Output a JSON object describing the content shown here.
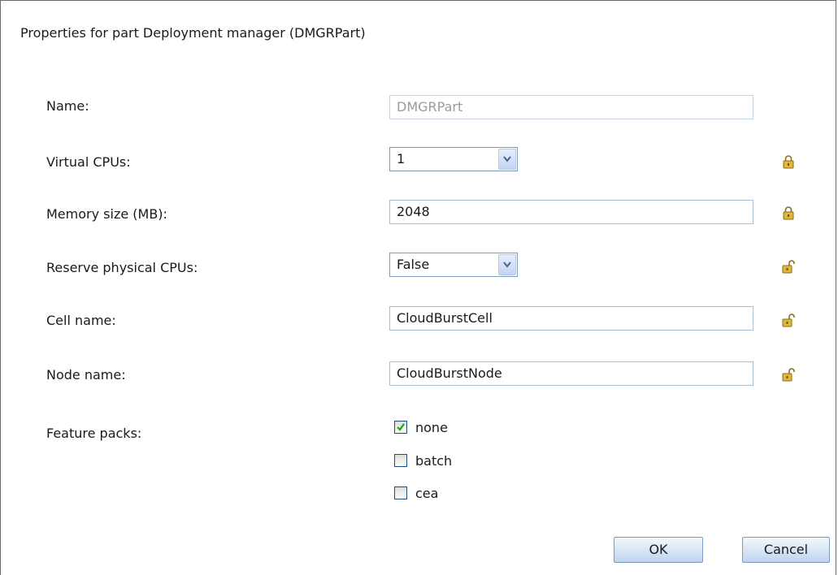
{
  "dialog": {
    "title": "Properties for part Deployment manager (DMGRPart)"
  },
  "fields": {
    "name": {
      "label": "Name:",
      "value": "DMGRPart"
    },
    "virtual_cpus": {
      "label": "Virtual CPUs:",
      "value": "1",
      "locked": true
    },
    "memory": {
      "label": "Memory size (MB):",
      "value": "2048",
      "locked": true
    },
    "reserve_cpus": {
      "label": "Reserve physical CPUs:",
      "value": "False",
      "locked": false
    },
    "cell_name": {
      "label": "Cell name:",
      "value": "CloudBurstCell",
      "locked": false
    },
    "node_name": {
      "label": "Node name:",
      "value": "CloudBurstNode",
      "locked": false
    },
    "feature_packs": {
      "label": "Feature packs:",
      "options": [
        {
          "label": "none",
          "checked": true
        },
        {
          "label": "batch",
          "checked": false
        },
        {
          "label": "cea",
          "checked": false
        }
      ]
    }
  },
  "buttons": {
    "ok": "OK",
    "cancel": "Cancel"
  },
  "colors": {
    "lock_gold": "#d4a017",
    "check_green": "#21a121",
    "button_border": "#7a9cc3"
  }
}
